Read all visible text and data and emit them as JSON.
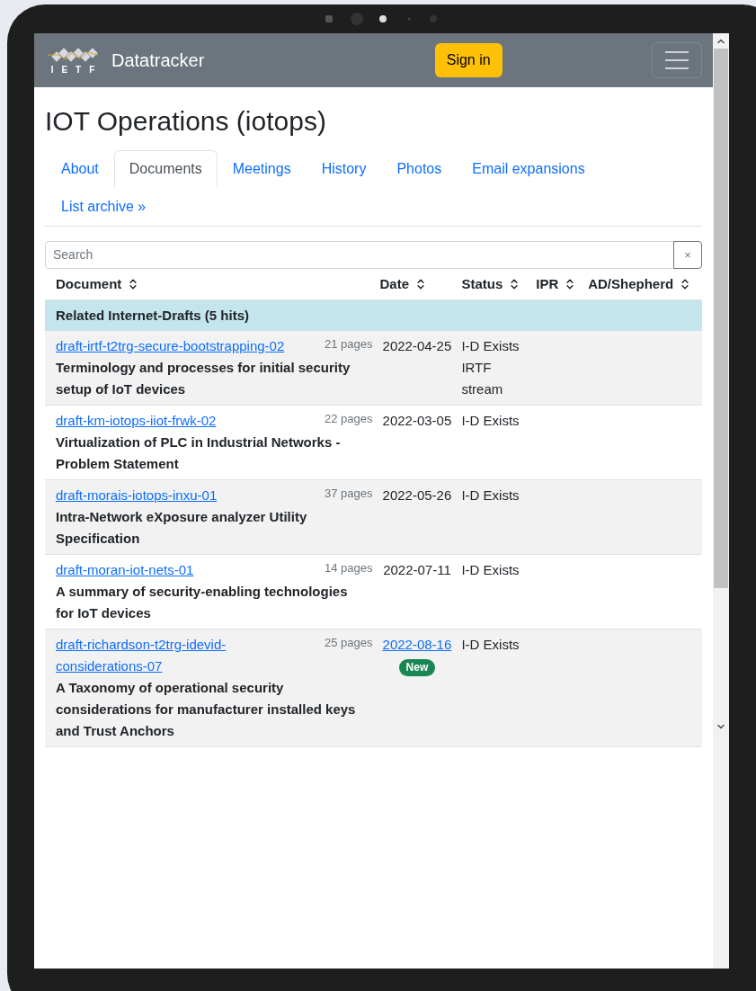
{
  "navbar": {
    "logo_letters": "IETF",
    "brand": "Datatracker",
    "sign_in": "Sign in"
  },
  "title": "IOT Operations (iotops)",
  "tabs": [
    {
      "label": "About",
      "selected": false
    },
    {
      "label": "Documents",
      "selected": true
    },
    {
      "label": "Meetings",
      "selected": false
    },
    {
      "label": "History",
      "selected": false
    },
    {
      "label": "Photos",
      "selected": false
    },
    {
      "label": "Email expansions",
      "selected": false
    },
    {
      "label": "List archive »",
      "selected": false
    }
  ],
  "search": {
    "placeholder": "Search",
    "clear": "×"
  },
  "table": {
    "columns": [
      "Document",
      "Date",
      "Status",
      "IPR",
      "AD/Shepherd"
    ],
    "group": "Related Internet-Drafts (5 hits)",
    "rows": [
      {
        "name": "draft-irtf-t2trg-secure-bootstrapping-02",
        "pages": "21 pages",
        "title": "Terminology and processes for initial security setup of IoT devices",
        "date": "2022-04-25",
        "date_linked": false,
        "status": "I-D Exists IRTF stream"
      },
      {
        "name": "draft-km-iotops-iiot-frwk-02",
        "pages": "22 pages",
        "title": "Virtualization of PLC in Industrial Networks - Problem Statement",
        "date": "2022-03-05",
        "date_linked": false,
        "status": "I-D Exists"
      },
      {
        "name": "draft-morais-iotops-inxu-01",
        "pages": "37 pages",
        "title": "Intra-Network eXposure analyzer Utility Specification",
        "date": "2022-05-26",
        "date_linked": false,
        "status": "I-D Exists"
      },
      {
        "name": "draft-moran-iot-nets-01",
        "pages": "14 pages",
        "title": "A summary of security-enabling technologies for IoT devices",
        "date": "2022-07-11",
        "date_linked": false,
        "status": "I-D Exists"
      },
      {
        "name": "draft-richardson-t2trg-idevid-considerations-07",
        "pages": "25 pages",
        "title": "A Taxonomy of operational security considerations for manufacturer installed keys and Trust Anchors",
        "date": "2022-08-16",
        "date_linked": true,
        "badge": "New",
        "status": "I-D Exists"
      }
    ]
  }
}
